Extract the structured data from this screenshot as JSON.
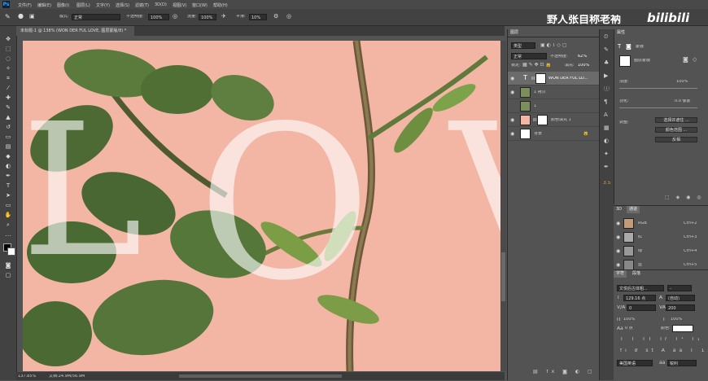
{
  "app": {
    "logo": "Ps"
  },
  "menu": [
    "文件(F)",
    "编辑(E)",
    "图像(I)",
    "图层(L)",
    "文字(Y)",
    "选择(S)",
    "滤镜(T)",
    "3D(D)",
    "视图(V)",
    "窗口(W)",
    "帮助(H)"
  ],
  "options": {
    "mode_label": "模式:",
    "mode_value": "正常",
    "opacity_label": "不透明度:",
    "opacity_value": "100%",
    "flow_label": "流量:",
    "flow_value": "100%",
    "smooth_label": "平滑:",
    "smooth_value": "10%"
  },
  "watermark": {
    "text": "野人张自称老衲",
    "brand": "bilibili"
  },
  "document": {
    "tab_label": "未标题-1 @ 138% (WON DER FUL LOVE, 图层蒙版/8) *",
    "zoom": "137.85%",
    "doc_info": "文档:24.9M/56.9M"
  },
  "canvas_text": {
    "letters": [
      "L",
      "O",
      "V"
    ]
  },
  "layers_panel": {
    "tab": "图层",
    "kind_label": "类型",
    "blend_mode": "正常",
    "opacity_label": "不透明度:",
    "opacity_value": "62%",
    "lock_label": "锁定:",
    "fill_label": "填充:",
    "fill_value": "100%",
    "layers": [
      {
        "name": "WON DER FUL LO...",
        "type": "text"
      },
      {
        "name": "1 拷贝",
        "type": "image"
      },
      {
        "name": "1",
        "type": "image"
      },
      {
        "name": "颜色填充 1",
        "type": "fill"
      },
      {
        "name": "背景",
        "type": "background"
      }
    ],
    "colors": {
      "fill": "#f3b6a5",
      "selected": "#6b6b6b"
    }
  },
  "properties": {
    "tab": "属性",
    "mask_label": "蒙版",
    "layer_mask": "图层蒙版",
    "density_label": "浓度:",
    "density_value": "100%",
    "feather_label": "羽化:",
    "feather_value": "0.0 像素",
    "adjust_label": "调整:",
    "btn_select": "选择并遮住 ...",
    "btn_color": "颜色范围 ...",
    "btn_invert": "反相"
  },
  "channels": {
    "tabs": [
      "3D",
      "通道"
    ],
    "rows": [
      {
        "name": "RGB",
        "shortcut": "Ctrl+2"
      },
      {
        "name": "红",
        "shortcut": "Ctrl+3"
      },
      {
        "name": "绿",
        "shortcut": "Ctrl+4"
      },
      {
        "name": "蓝",
        "shortcut": "Ctrl+5"
      }
    ]
  },
  "character": {
    "tabs": [
      "字符",
      "段落"
    ],
    "font": "文悦后古体粗...",
    "size": "129.16 点",
    "leading": "(自动)",
    "kerning": "0",
    "tracking": "200",
    "vscale": "100%",
    "hscale": "100%",
    "baseline": "0 点",
    "color_label": "颜色:",
    "lang": "美国英语",
    "aa": "锐利",
    "aa_label": "aa"
  }
}
